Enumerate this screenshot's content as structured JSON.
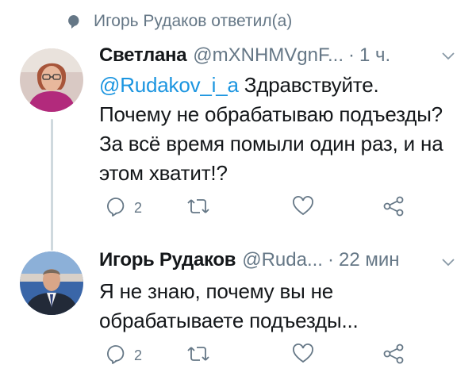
{
  "context": {
    "text": "Игорь Рудаков ответил(а)",
    "icon": "speech-bubble-icon"
  },
  "tweets": [
    {
      "author": "Светлана",
      "handle": "@mXNHMVgnF...",
      "time": "1 ч.",
      "mention": "@Rudakov_i_a",
      "text": " Здравствуйте. Почему не обрабатываю подъезды? За всё время помыли один раз, и на этом хватит!?",
      "reply_count": "2"
    },
    {
      "author": "Игорь Рудаков",
      "handle": "@Ruda...",
      "time": "22 мин",
      "text": "Я не знаю, почему вы не обрабатываете подъезды...",
      "reply_count": "2"
    }
  ],
  "colors": {
    "link": "#1b95e0",
    "muted": "#657786",
    "thread": "#cfd9de"
  }
}
